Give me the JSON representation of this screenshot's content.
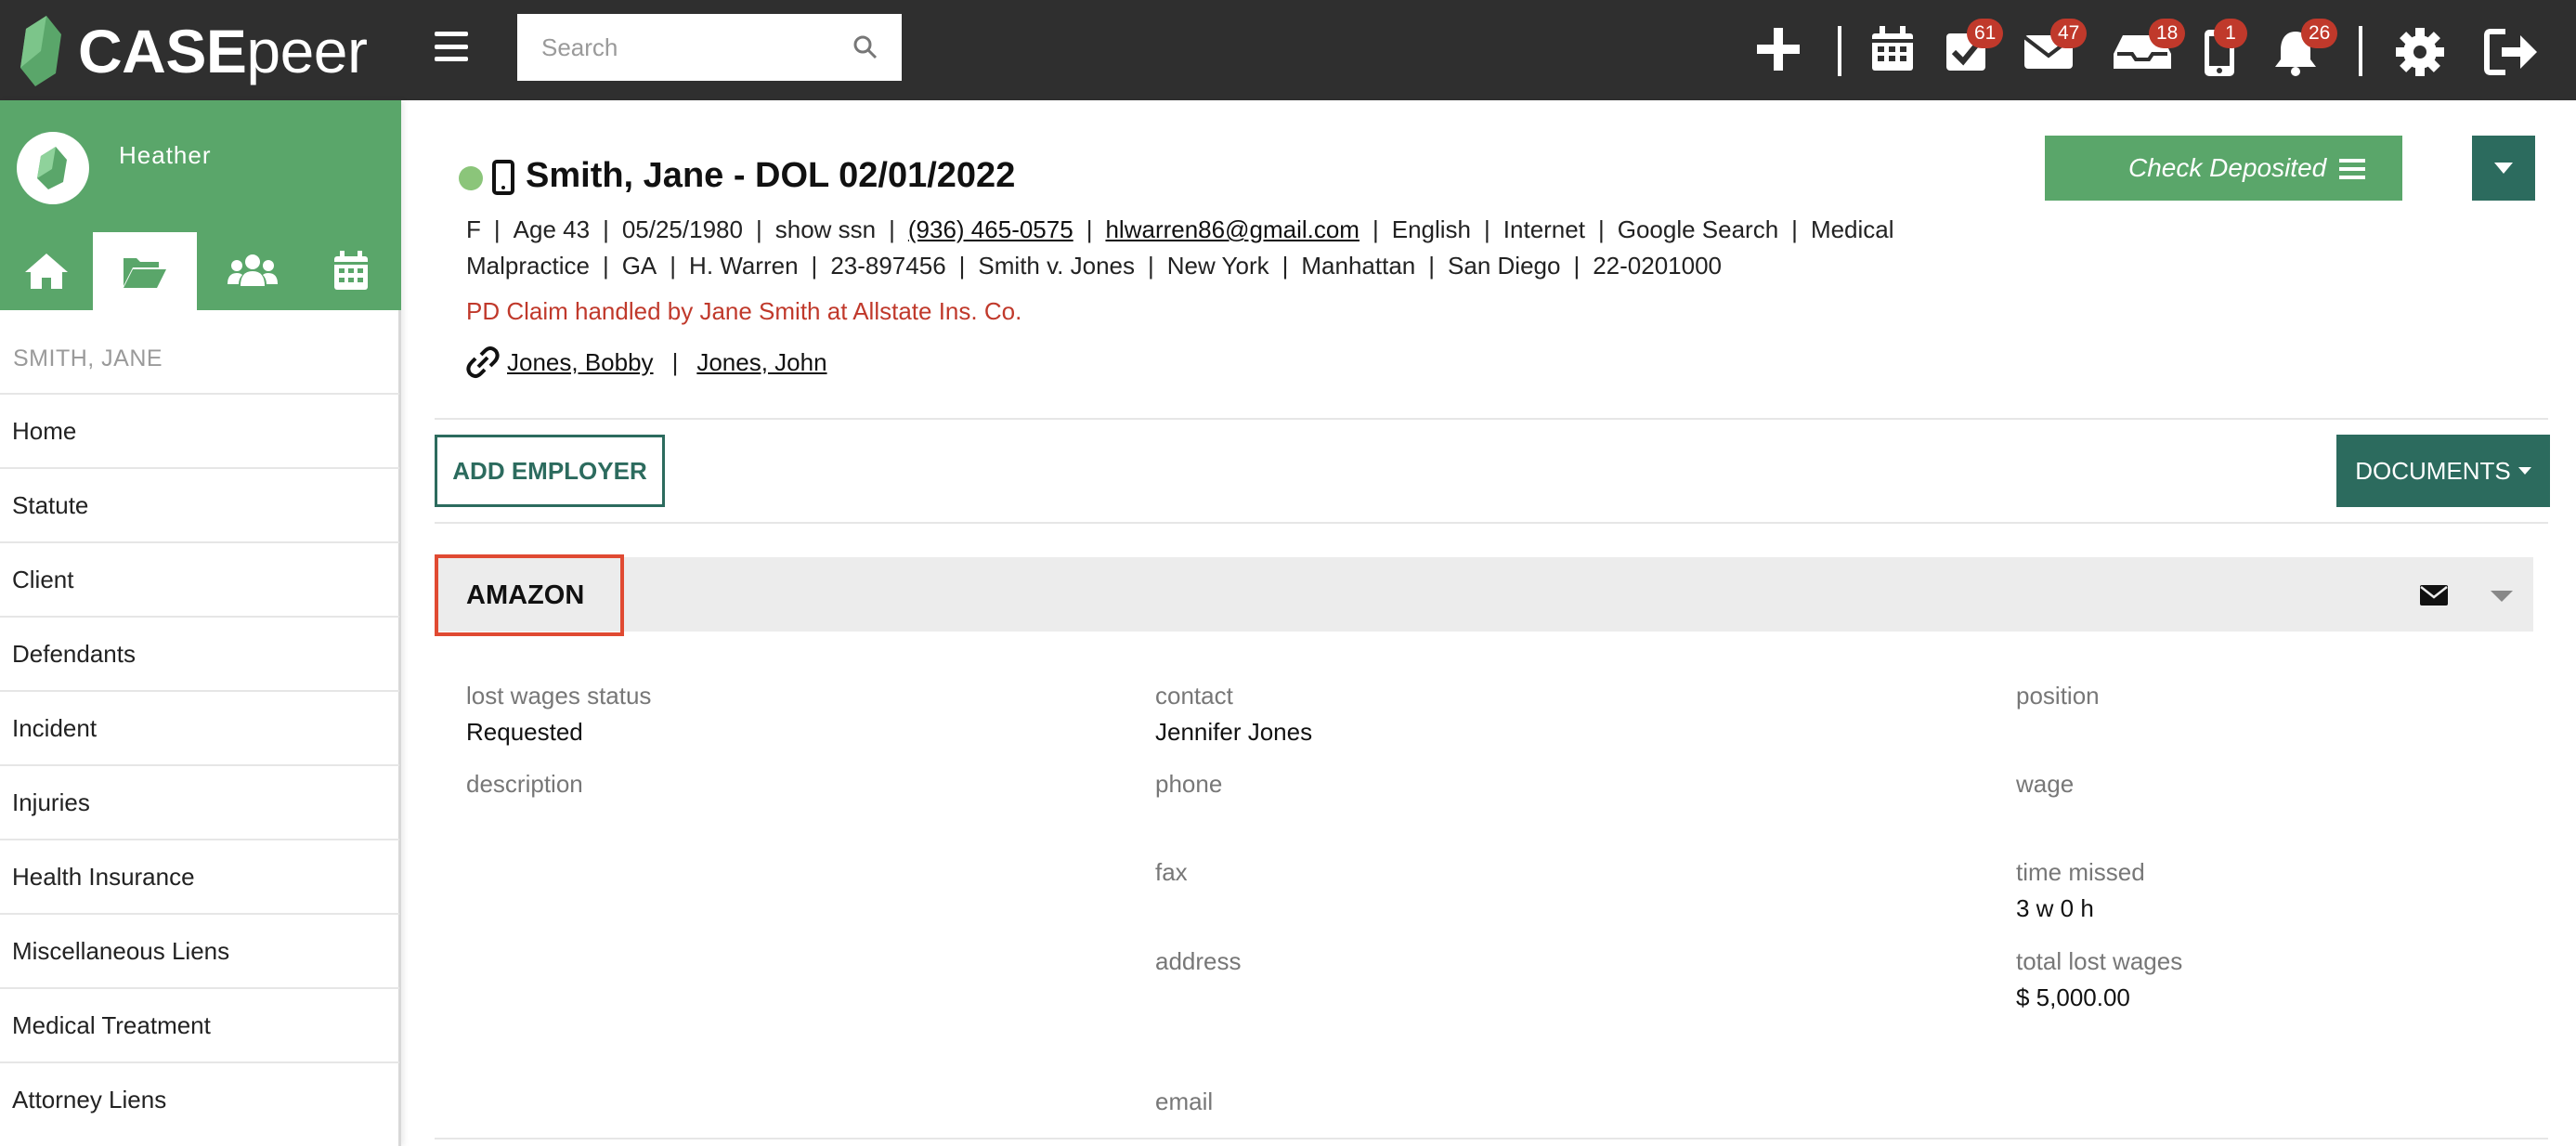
{
  "app": {
    "brand_prefix": "CASE",
    "brand_suffix": "peer"
  },
  "search": {
    "placeholder": "Search"
  },
  "topbar": {
    "badges": {
      "tasks": "61",
      "mail": "47",
      "inbox": "18",
      "mobile": "1",
      "notifications": "26"
    }
  },
  "sidebar": {
    "user": "Heather",
    "client_name": "SMITH, JANE",
    "items": [
      {
        "label": "Home"
      },
      {
        "label": "Statute"
      },
      {
        "label": "Client"
      },
      {
        "label": "Defendants"
      },
      {
        "label": "Incident"
      },
      {
        "label": "Injuries"
      },
      {
        "label": "Health Insurance"
      },
      {
        "label": "Miscellaneous Liens"
      },
      {
        "label": "Medical Treatment"
      },
      {
        "label": "Attorney Liens"
      }
    ]
  },
  "case": {
    "title": "Smith, Jane - DOL 02/01/2022",
    "line1": {
      "gender": "F",
      "age": "Age 43",
      "dob": "05/25/1980",
      "ssn": "show ssn",
      "phone": "(936) 465-0575",
      "email": "hlwarren86@gmail.com",
      "language": "English",
      "source": "Internet",
      "source_detail": "Google Search",
      "case_type_start": "Medical"
    },
    "line2": {
      "case_type_end": "Malpractice",
      "state": "GA",
      "attorney": "H. Warren",
      "case_no": "23-897456",
      "caption": "Smith v. Jones",
      "city": "New York",
      "area": "Manhattan",
      "office": "San Diego",
      "ref": "22-0201000"
    },
    "pd_claim": "PD Claim handled by Jane Smith at Allstate Ins. Co.",
    "related": [
      "Jones, Bobby",
      "Jones, John"
    ],
    "status_button": "Check Deposited"
  },
  "actions": {
    "add_employer": "ADD EMPLOYER",
    "documents": "DOCUMENTS"
  },
  "employer": {
    "name": "AMAZON",
    "fields": {
      "lost_wages_status": {
        "label": "lost wages status",
        "value": "Requested"
      },
      "description": {
        "label": "description",
        "value": ""
      },
      "contact": {
        "label": "contact",
        "value": "Jennifer Jones"
      },
      "phone": {
        "label": "phone",
        "value": ""
      },
      "fax": {
        "label": "fax",
        "value": ""
      },
      "address": {
        "label": "address",
        "value": ""
      },
      "email": {
        "label": "email",
        "value": ""
      },
      "position": {
        "label": "position",
        "value": ""
      },
      "wage": {
        "label": "wage",
        "value": ""
      },
      "time_missed": {
        "label": "time missed",
        "value": "3 w 0 h"
      },
      "total_lost_wages": {
        "label": "total lost wages",
        "value": "$ 5,000.00"
      }
    }
  },
  "colors": {
    "topbar": "#2f2f2f",
    "brand_green": "#5aa66a",
    "dark_teal": "#2c6b5e",
    "badge_red": "#c0392b",
    "highlight_red": "#e04a32"
  }
}
